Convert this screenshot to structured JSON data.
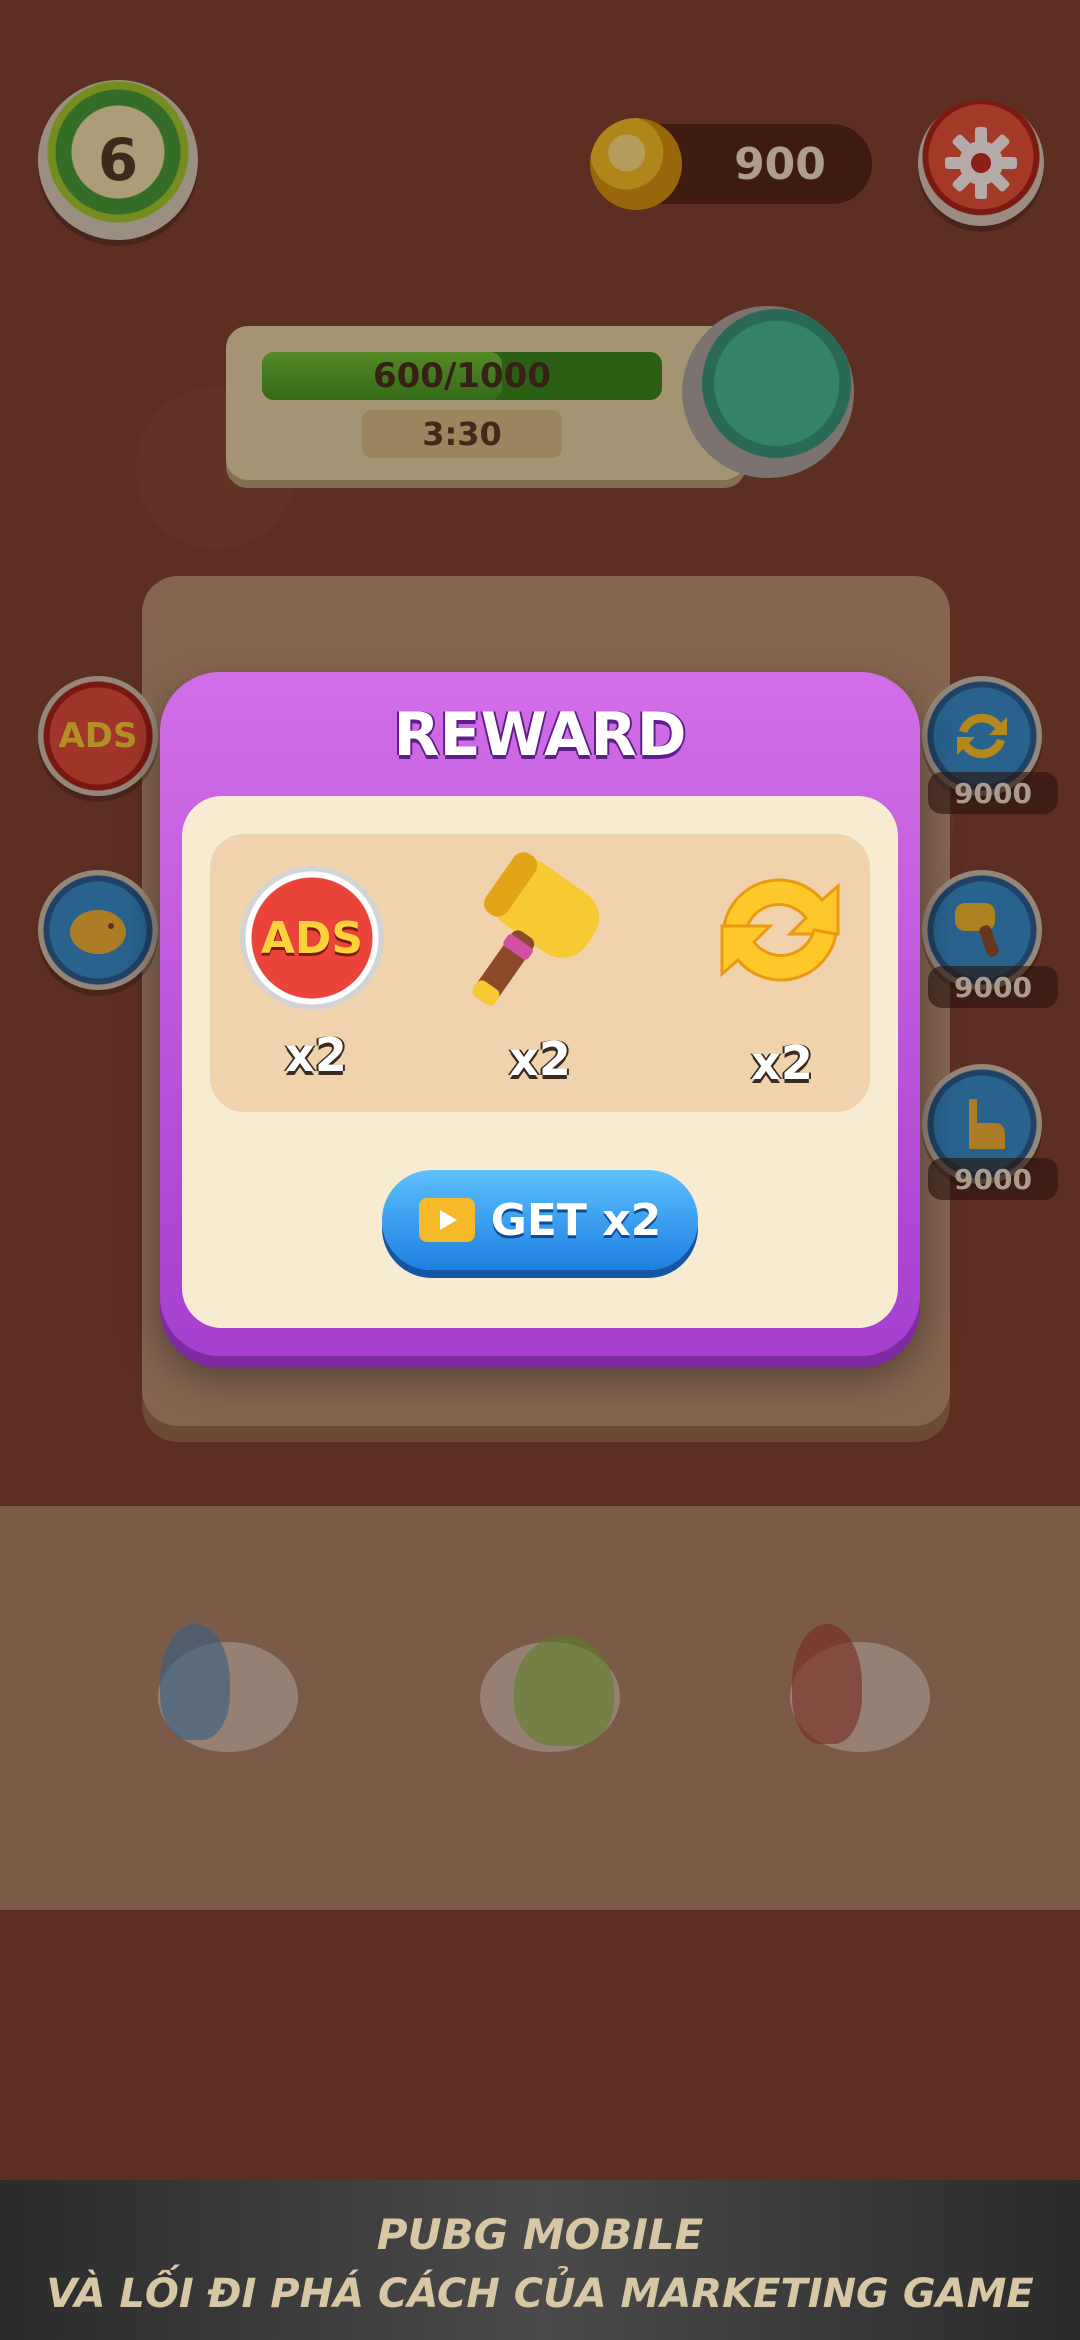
{
  "hud": {
    "level": "6",
    "coins": "900",
    "progress_text": "600/1000",
    "progress_fraction": 0.6,
    "timer": "3:30"
  },
  "side_buttons": {
    "left": [
      {
        "label": "ADS",
        "icon": "ads-icon"
      },
      {
        "icon": "piggy-bank-icon"
      }
    ],
    "right": [
      {
        "icon": "shuffle-icon",
        "price": "9000"
      },
      {
        "icon": "hammer-icon",
        "price": "9000"
      },
      {
        "icon": "hand-pointer-icon",
        "price": "9000"
      }
    ]
  },
  "modal": {
    "title": "REWARD",
    "items": [
      {
        "icon": "no-ads-icon",
        "icon_label": "ADS",
        "count": "x2"
      },
      {
        "icon": "hammer-icon",
        "count": "x2"
      },
      {
        "icon": "shuffle-icon",
        "count": "x2"
      }
    ],
    "get_button_label": "GET x2"
  },
  "banner": {
    "title": "PUBG MOBILE",
    "subtitle": "VÀ LỐI ĐI PHÁ CÁCH CỦA MARKETING GAME"
  },
  "colors": {
    "modal_purple": "#b04ad8",
    "button_blue": "#2f95ea",
    "coin_gold": "#f6c625",
    "progress_green": "#4bb02a"
  }
}
